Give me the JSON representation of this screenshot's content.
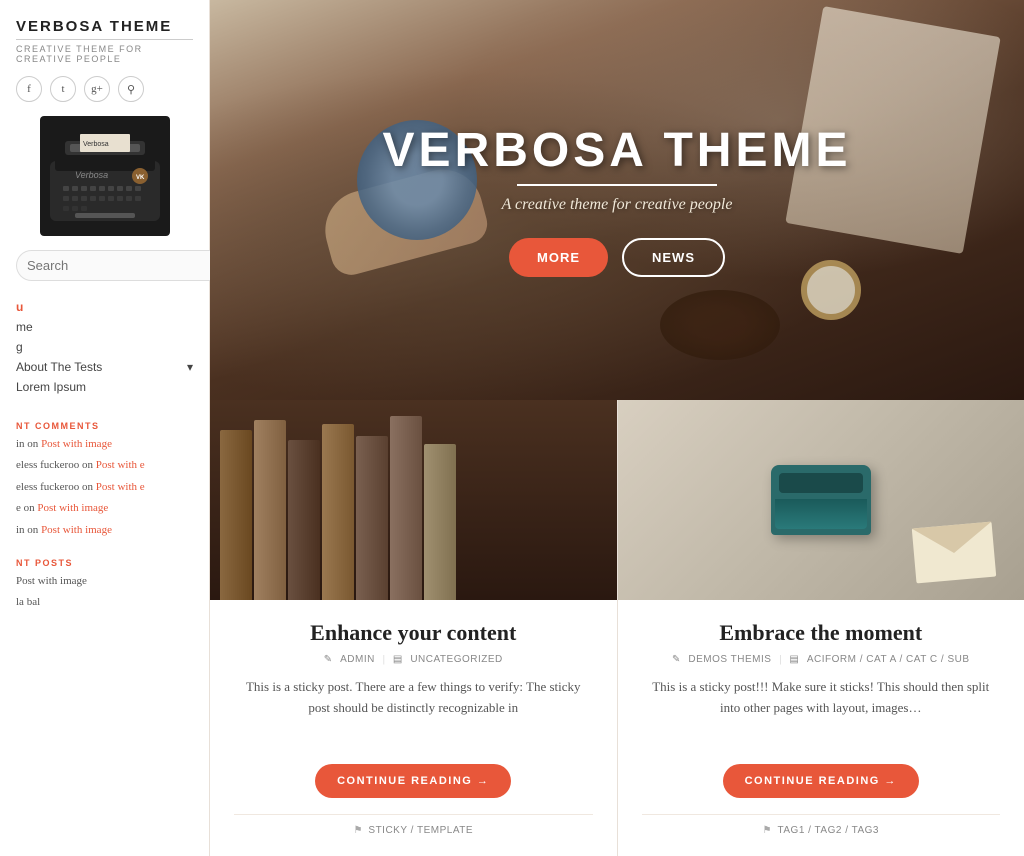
{
  "sidebar": {
    "site_title": "VERBOSA THEME",
    "site_subtitle": "CREATIVE THEME FOR CREATIVE PEOPLE",
    "social_icons": [
      {
        "name": "facebook",
        "symbol": "f"
      },
      {
        "name": "twitter",
        "symbol": "t"
      },
      {
        "name": "google-plus",
        "symbol": "g+"
      },
      {
        "name": "link",
        "symbol": "🔗"
      }
    ],
    "search_placeholder": "Search",
    "search_button_label": "🔍",
    "nav_items": [
      {
        "label": "u",
        "active": true
      },
      {
        "label": "me"
      },
      {
        "label": "g"
      },
      {
        "label": "About The Tests",
        "has_arrow": true
      },
      {
        "label": "Lorem Ipsum"
      }
    ],
    "recent_comments_label": "NT COMMENTS",
    "comments": [
      {
        "text": "in on Post with image"
      },
      {
        "text": "eless fuckeroo on Post with e"
      },
      {
        "text": "eless fuckeroo on Post with e"
      },
      {
        "text": "e on Post with image"
      },
      {
        "text": "in on Post with image"
      }
    ],
    "recent_posts_label": "NT POSTS",
    "recent_posts": [
      {
        "label": "Post with image"
      },
      {
        "label": "la bal"
      }
    ]
  },
  "hero": {
    "title": "VERBOSA THEME",
    "subtitle": "A creative theme for creative people",
    "btn_more": "MORE",
    "btn_news": "NEWS"
  },
  "posts": [
    {
      "title": "Enhance your content",
      "author": "ADMIN",
      "category": "UNCATEGORIZED",
      "excerpt": "This is a sticky post. There are a few things to verify: The sticky post should be distinctly recognizable in",
      "continue_btn": "CONTINUE READING →",
      "tags": "STICKY / TEMPLATE",
      "image_type": "books"
    },
    {
      "title": "Embrace the moment",
      "author": "DEMOS THEMIS",
      "category": "ACIFORM / CAT A / CAT C / SUB",
      "excerpt": "This is a sticky post!!! Make sure it sticks! This should then split into other pages with layout, images…",
      "continue_btn": "CONTINUE READING →",
      "tags": "TAG1 / TAG2 / TAG3",
      "image_type": "typewriter"
    }
  ]
}
